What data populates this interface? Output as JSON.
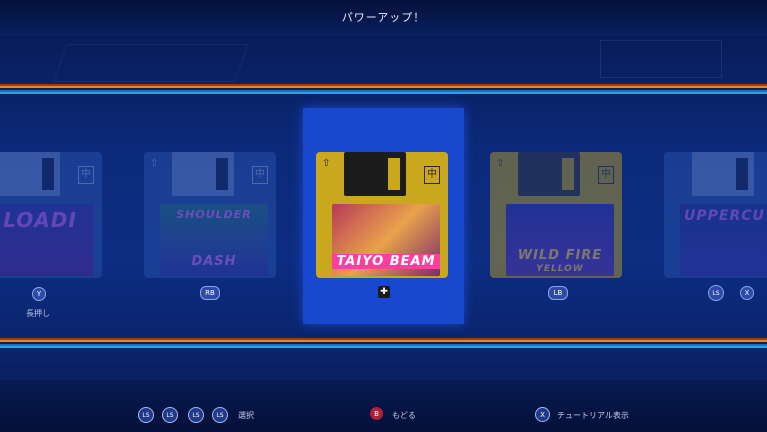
{
  "header": {
    "title": "パワーアップ！"
  },
  "disks": [
    {
      "art_text": "LOADI",
      "button": "Y",
      "hold_label": "長押し"
    },
    {
      "art_text_top": "SHOULDER",
      "art_text_bottom": "DASH",
      "button": "RB"
    },
    {
      "art_text": "TAIYO BEAM",
      "selected": true
    },
    {
      "art_text_top": "WILD FIRE",
      "art_text_bottom": "YELLOW",
      "button": "LB"
    },
    {
      "art_text": "UPPERCU",
      "button": "LS",
      "button2": "X"
    }
  ],
  "disk_glyph": "中",
  "footer": {
    "select_buttons": [
      "LS",
      "LS",
      "LS",
      "LS"
    ],
    "select_label": "選択",
    "back_button": "B",
    "back_label": "もどる",
    "tutorial_button": "X",
    "tutorial_label": "チュートリアル表示"
  },
  "colors": {
    "selected_bg": "#1848d0",
    "disk_gold": "#c9a81e",
    "accent_pink": "#ff3ea0"
  }
}
